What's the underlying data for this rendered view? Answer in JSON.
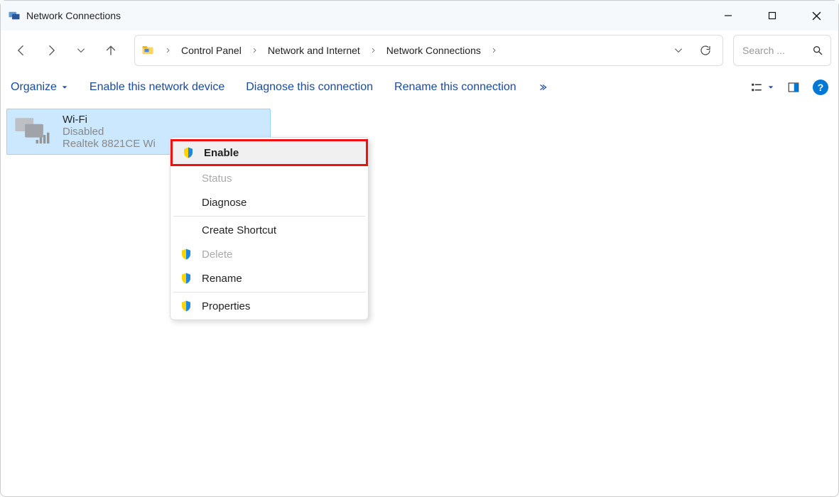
{
  "window": {
    "title": "Network Connections"
  },
  "breadcrumb": {
    "items": [
      "Control Panel",
      "Network and Internet",
      "Network Connections"
    ]
  },
  "search": {
    "placeholder": "Search ..."
  },
  "commands": {
    "organize": "Organize",
    "enable": "Enable this network device",
    "diagnose": "Diagnose this connection",
    "rename": "Rename this connection"
  },
  "connection": {
    "name": "Wi-Fi",
    "status": "Disabled",
    "adapter": "Realtek 8821CE Wi"
  },
  "contextMenu": {
    "enable": "Enable",
    "status": "Status",
    "diagnose": "Diagnose",
    "createShortcut": "Create Shortcut",
    "delete": "Delete",
    "rename": "Rename",
    "properties": "Properties"
  }
}
